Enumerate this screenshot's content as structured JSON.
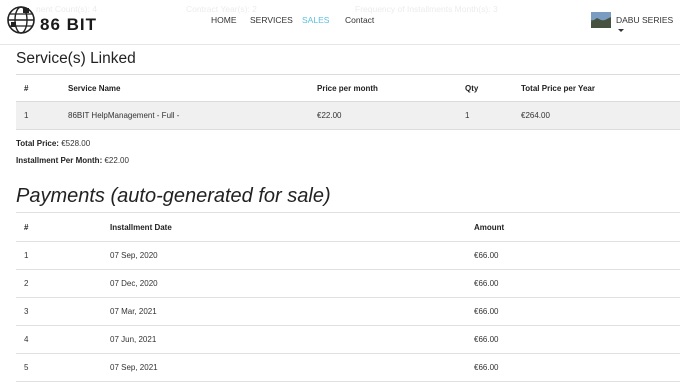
{
  "header": {
    "ghost_items": [
      "nent Count(s): 4",
      "Contract Year(s): 2",
      "Frequency of Installments Month(s): 3"
    ],
    "brand": "86 BIT",
    "nav": [
      "HOME",
      "SERVICES",
      "SALES",
      "Contact"
    ],
    "active_nav": "SALES",
    "user": "DABU SERIES"
  },
  "services": {
    "title": "Service(s) Linked",
    "columns": [
      "#",
      "Service Name",
      "Price per month",
      "Qty",
      "Total Price per Year"
    ],
    "rows": [
      [
        "1",
        "86BIT HelpManagement - Full -",
        "€22.00",
        "1",
        "€264.00"
      ]
    ]
  },
  "totals": {
    "total_label": "Total Price:",
    "total_value": "€528.00",
    "installment_label": "Installment Per Month:",
    "installment_value": "€22.00"
  },
  "payments": {
    "title": "Payments (auto-generated for sale)",
    "columns": [
      "#",
      "Installment Date",
      "Amount"
    ],
    "rows": [
      [
        "1",
        "07 Sep, 2020",
        "€66.00"
      ],
      [
        "2",
        "07 Dec, 2020",
        "€66.00"
      ],
      [
        "3",
        "07 Mar, 2021",
        "€66.00"
      ],
      [
        "4",
        "07 Jun, 2021",
        "€66.00"
      ],
      [
        "5",
        "07 Sep, 2021",
        "€66.00"
      ]
    ]
  }
}
